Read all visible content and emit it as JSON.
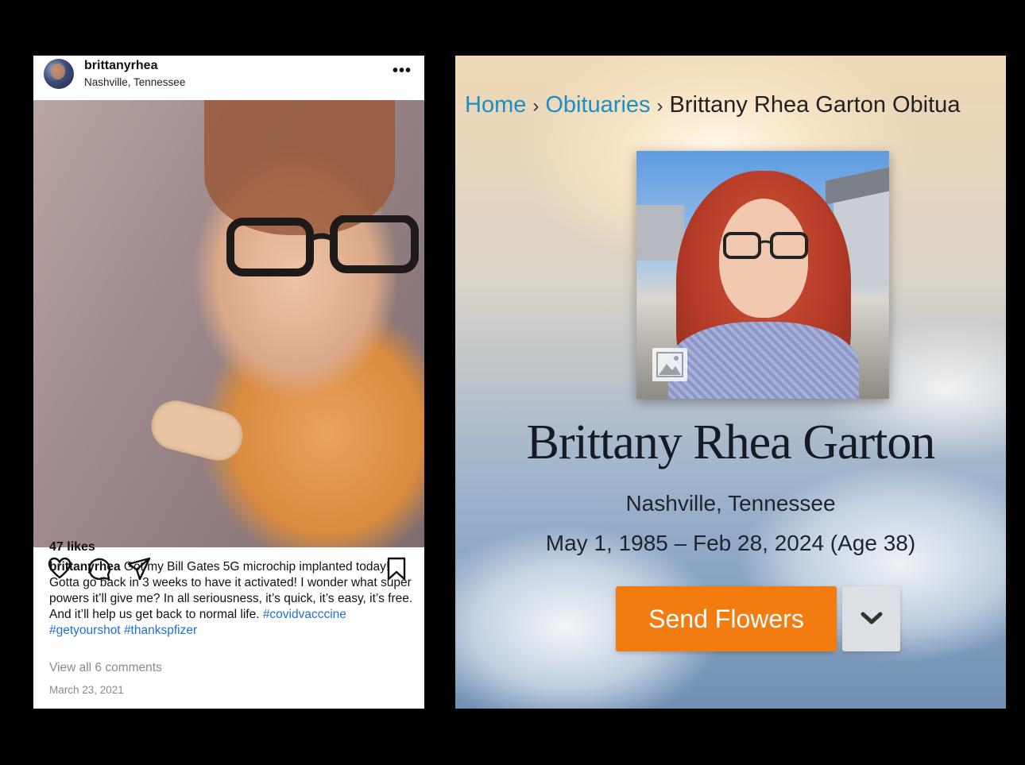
{
  "instagram": {
    "username": "brittanyrhea",
    "location": "Nashville, Tennessee",
    "more_label": "•••",
    "likes": "47 likes",
    "caption_user": "brittanyrhea",
    "caption_text": " Got my Bill Gates 5G microchip implanted today! Gotta go back in 3 weeks to have it activated! I wonder what super powers it’ll give me? In all seriousness, it’s quick, it’s easy, it’s free. And it’ll help us get back to normal life. ",
    "hashtag_1": "#covidvacccine",
    "hashtag_2": "#getyourshot",
    "hashtag_3": "#thankspfizer",
    "view_comments": "View all 6 comments",
    "date": "March 23, 2021",
    "icons": [
      "heart-icon",
      "comment-icon",
      "share-icon",
      "bookmark-icon"
    ]
  },
  "obituary": {
    "breadcrumb": {
      "home": "Home",
      "obituaries": "Obituaries",
      "current": "Brittany Rhea Garton Obitua",
      "separator": "›"
    },
    "name": "Brittany Rhea Garton",
    "location": "Nashville, Tennessee",
    "dates": "May 1, 1985 – Feb 28, 2024 (Age 38)",
    "send_flowers_label": "Send Flowers",
    "colors": {
      "link": "#1a8fc4",
      "button": "#f37c10"
    }
  }
}
